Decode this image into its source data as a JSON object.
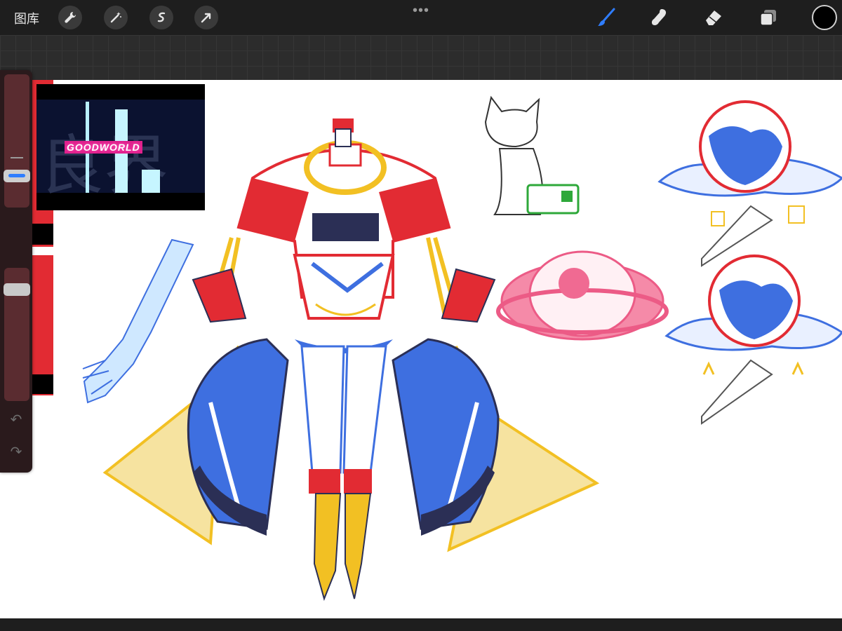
{
  "toolbar": {
    "gallery_label": "图库",
    "tools_left": [
      "wrench-icon",
      "magic-wand-icon",
      "selection-s-icon",
      "transform-arrow-icon"
    ],
    "more_label": "•••",
    "tools_right": [
      "brush-icon",
      "smudge-icon",
      "eraser-icon",
      "layers-icon"
    ],
    "current_color": "#000000",
    "active_tool_color": "#2f7dff"
  },
  "reference": {
    "overlay_text": "GOODWORLD",
    "background_glyphs": "良界"
  },
  "sidebar": {
    "brush_size_level": 0.66,
    "opacity_level": 0.86,
    "undo_icon": "↶",
    "redo_icon": "↷"
  },
  "canvas": {
    "background": "#ffffff",
    "palette": {
      "red": "#e22b33",
      "blue": "#3e6fe0",
      "yellow": "#f2c023",
      "pink": "#ec5b86",
      "green": "#2ea83a",
      "navy": "#2b2f55"
    }
  }
}
